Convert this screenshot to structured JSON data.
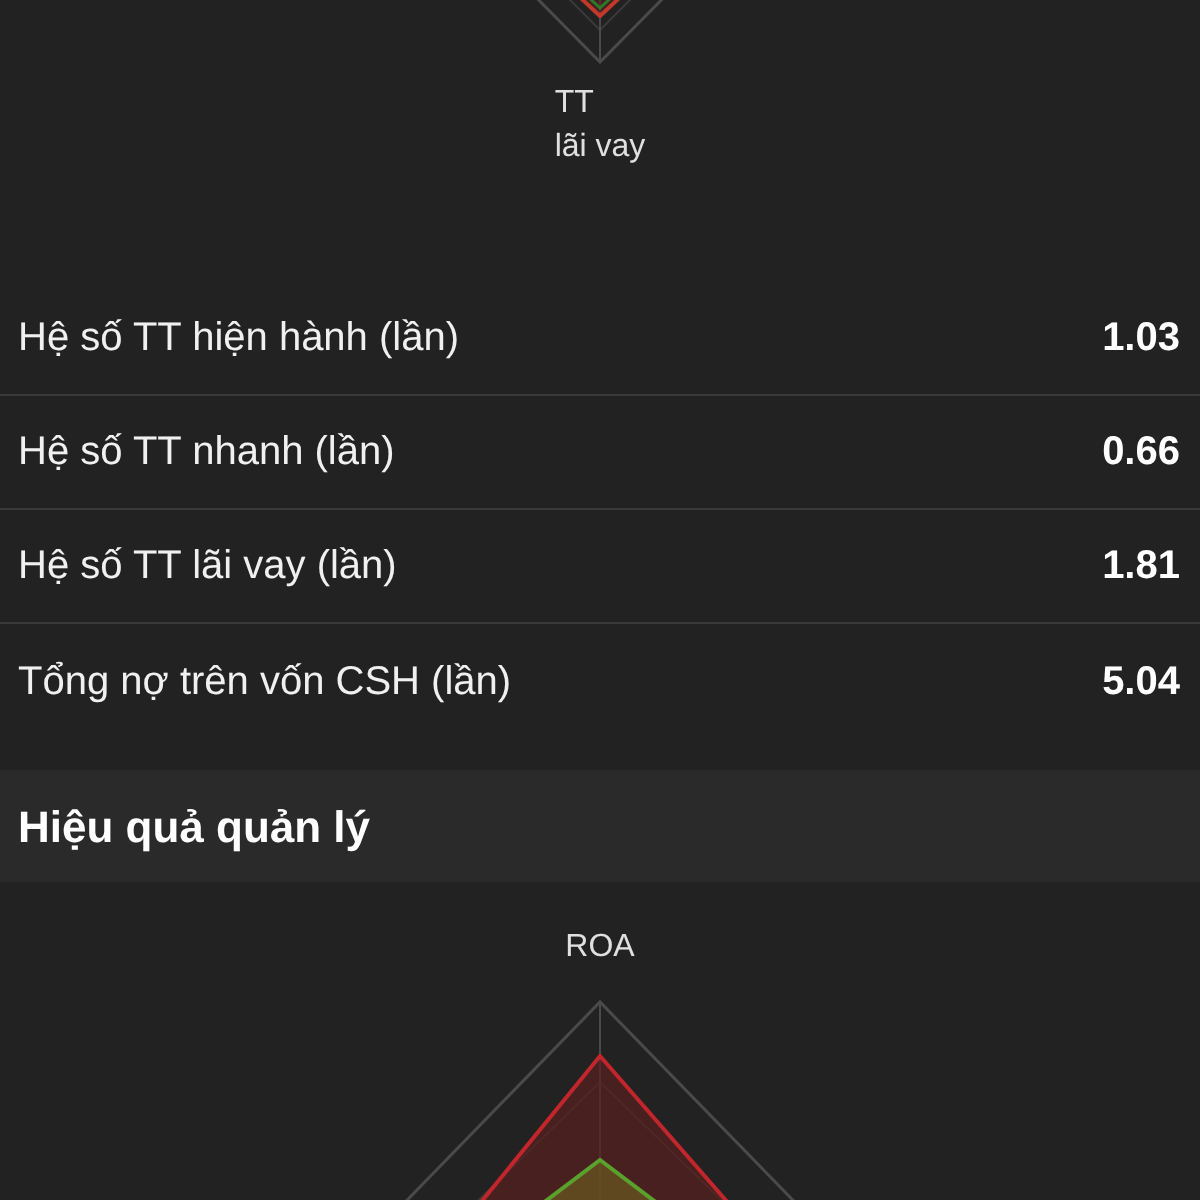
{
  "top_chart": {
    "axis_label_bottom": "TT\nlãi vay"
  },
  "ratios": [
    {
      "label": "Hệ số TT hiện hành (lần)",
      "value": "1.03"
    },
    {
      "label": "Hệ số TT nhanh (lần)",
      "value": "0.66"
    },
    {
      "label": "Hệ số TT lãi vay (lần)",
      "value": "1.81"
    },
    {
      "label": "Tổng nợ trên vốn CSH (lần)",
      "value": "5.04"
    }
  ],
  "section": {
    "title": "Hiệu quả quản lý"
  },
  "bottom_chart": {
    "axis_label_top": "ROA"
  }
}
